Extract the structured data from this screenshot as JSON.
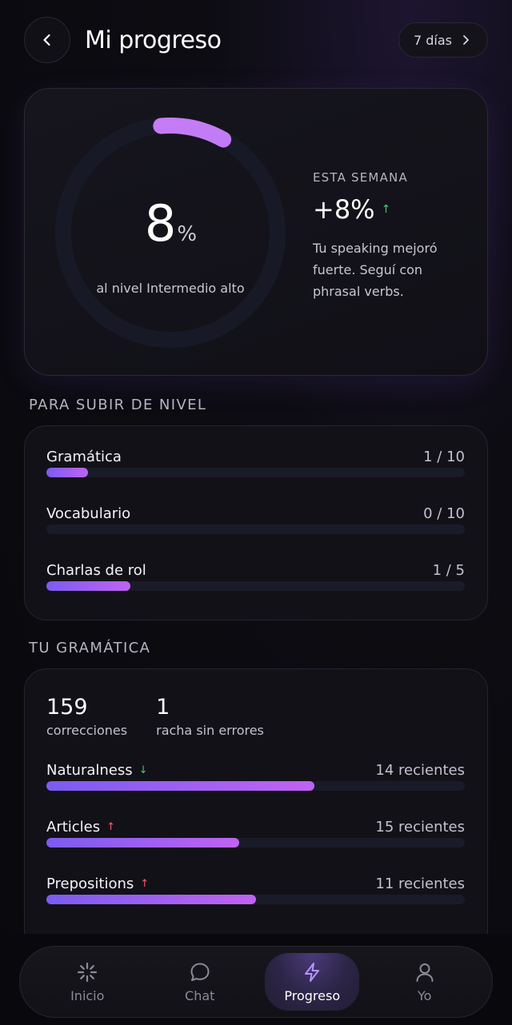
{
  "header": {
    "title": "Mi progreso",
    "range_label": "7 días"
  },
  "hero": {
    "progress_value": "8",
    "progress_unit": "%",
    "progress_fraction": 0.08,
    "progress_caption": "al nivel Intermedio alto",
    "week_label": "ESTA SEMANA",
    "week_value": "+8%",
    "week_message": "Tu speaking mejoró fuerte. Seguí con phrasal verbs."
  },
  "level_up": {
    "title": "PARA SUBIR DE NIVEL",
    "items": [
      {
        "label": "Gramática",
        "value": "1 / 10",
        "fraction": 0.1
      },
      {
        "label": "Vocabulario",
        "value": "0 / 10",
        "fraction": 0
      },
      {
        "label": "Charlas de rol",
        "value": "1 / 5",
        "fraction": 0.2
      }
    ]
  },
  "grammar": {
    "title": "TU GRAMÁTICA",
    "stats": [
      {
        "value": "159",
        "label": "correcciones"
      },
      {
        "value": "1",
        "label": "racha sin errores"
      }
    ],
    "items": [
      {
        "label": "Naturalness",
        "trend": "down",
        "value": "14 recientes",
        "fraction": 0.64
      },
      {
        "label": "Articles",
        "trend": "up",
        "value": "15 recientes",
        "fraction": 0.46
      },
      {
        "label": "Prepositions",
        "trend": "up",
        "value": "11 recientes",
        "fraction": 0.5
      }
    ]
  },
  "nav": {
    "items": [
      {
        "label": "Inicio",
        "icon": "sparkle-icon"
      },
      {
        "label": "Chat",
        "icon": "chat-bubble-icon"
      },
      {
        "label": "Progreso",
        "icon": "lightning-icon",
        "active": true
      },
      {
        "label": "Yo",
        "icon": "user-icon"
      }
    ]
  },
  "colors": {
    "accent_start": "#7b5cf0",
    "accent_end": "#c063f2",
    "trend_down": "#3ecf6e",
    "trend_up": "#ff5b6e"
  }
}
